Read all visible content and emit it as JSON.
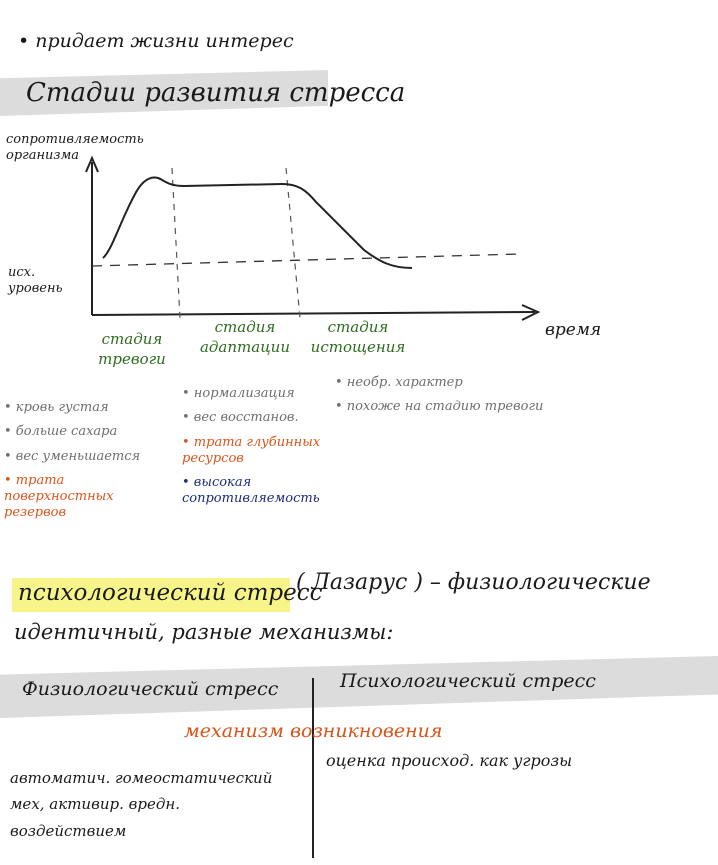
{
  "top_bullet": "• придает жизни интерес",
  "section_title": "Стадии развития стресса",
  "graph": {
    "y_label": "сопротивляемость организма",
    "baseline_label": "исх. уровень",
    "x_label": "время",
    "stages": [
      {
        "label": "стадия тревоги"
      },
      {
        "label": "стадия адаптации"
      },
      {
        "label": "стадия истощения"
      }
    ]
  },
  "alarm_notes": {
    "grey": [
      "• кровь густая",
      "• больше сахара",
      "• вес уменьшается"
    ],
    "orange": "• трата поверхностных резервов"
  },
  "adaptation_notes": {
    "grey": [
      "• нормализация",
      "• вес восстанов."
    ],
    "orange": "• трата глубинных ресурсов",
    "navy": "• высокая сопротивляемость"
  },
  "exhaustion_notes": {
    "grey": [
      "• необр. характер",
      "• похоже на стадию тревоги"
    ]
  },
  "psych_stress": {
    "highlight": "психологический стресс",
    "rest": "( Лазарус ) – физиологические",
    "line2": "идентичный, разные механизмы:"
  },
  "comparison": {
    "left_header": "Физиологический стресс",
    "right_header": "Психологический стресс",
    "mechanism_label": "механизм возникновения",
    "left_text": "автоматич. гомеостатический мех, активир. вредн. воздействием",
    "right_text": "оценка происход. как угрозы"
  },
  "colors": {
    "green": "#2e6b1f",
    "orange": "#d9541a",
    "navy": "#1d2b7a",
    "grey_text": "#6e6e6e",
    "highlight": "#f7f48a",
    "band": "#dcdcdc"
  }
}
